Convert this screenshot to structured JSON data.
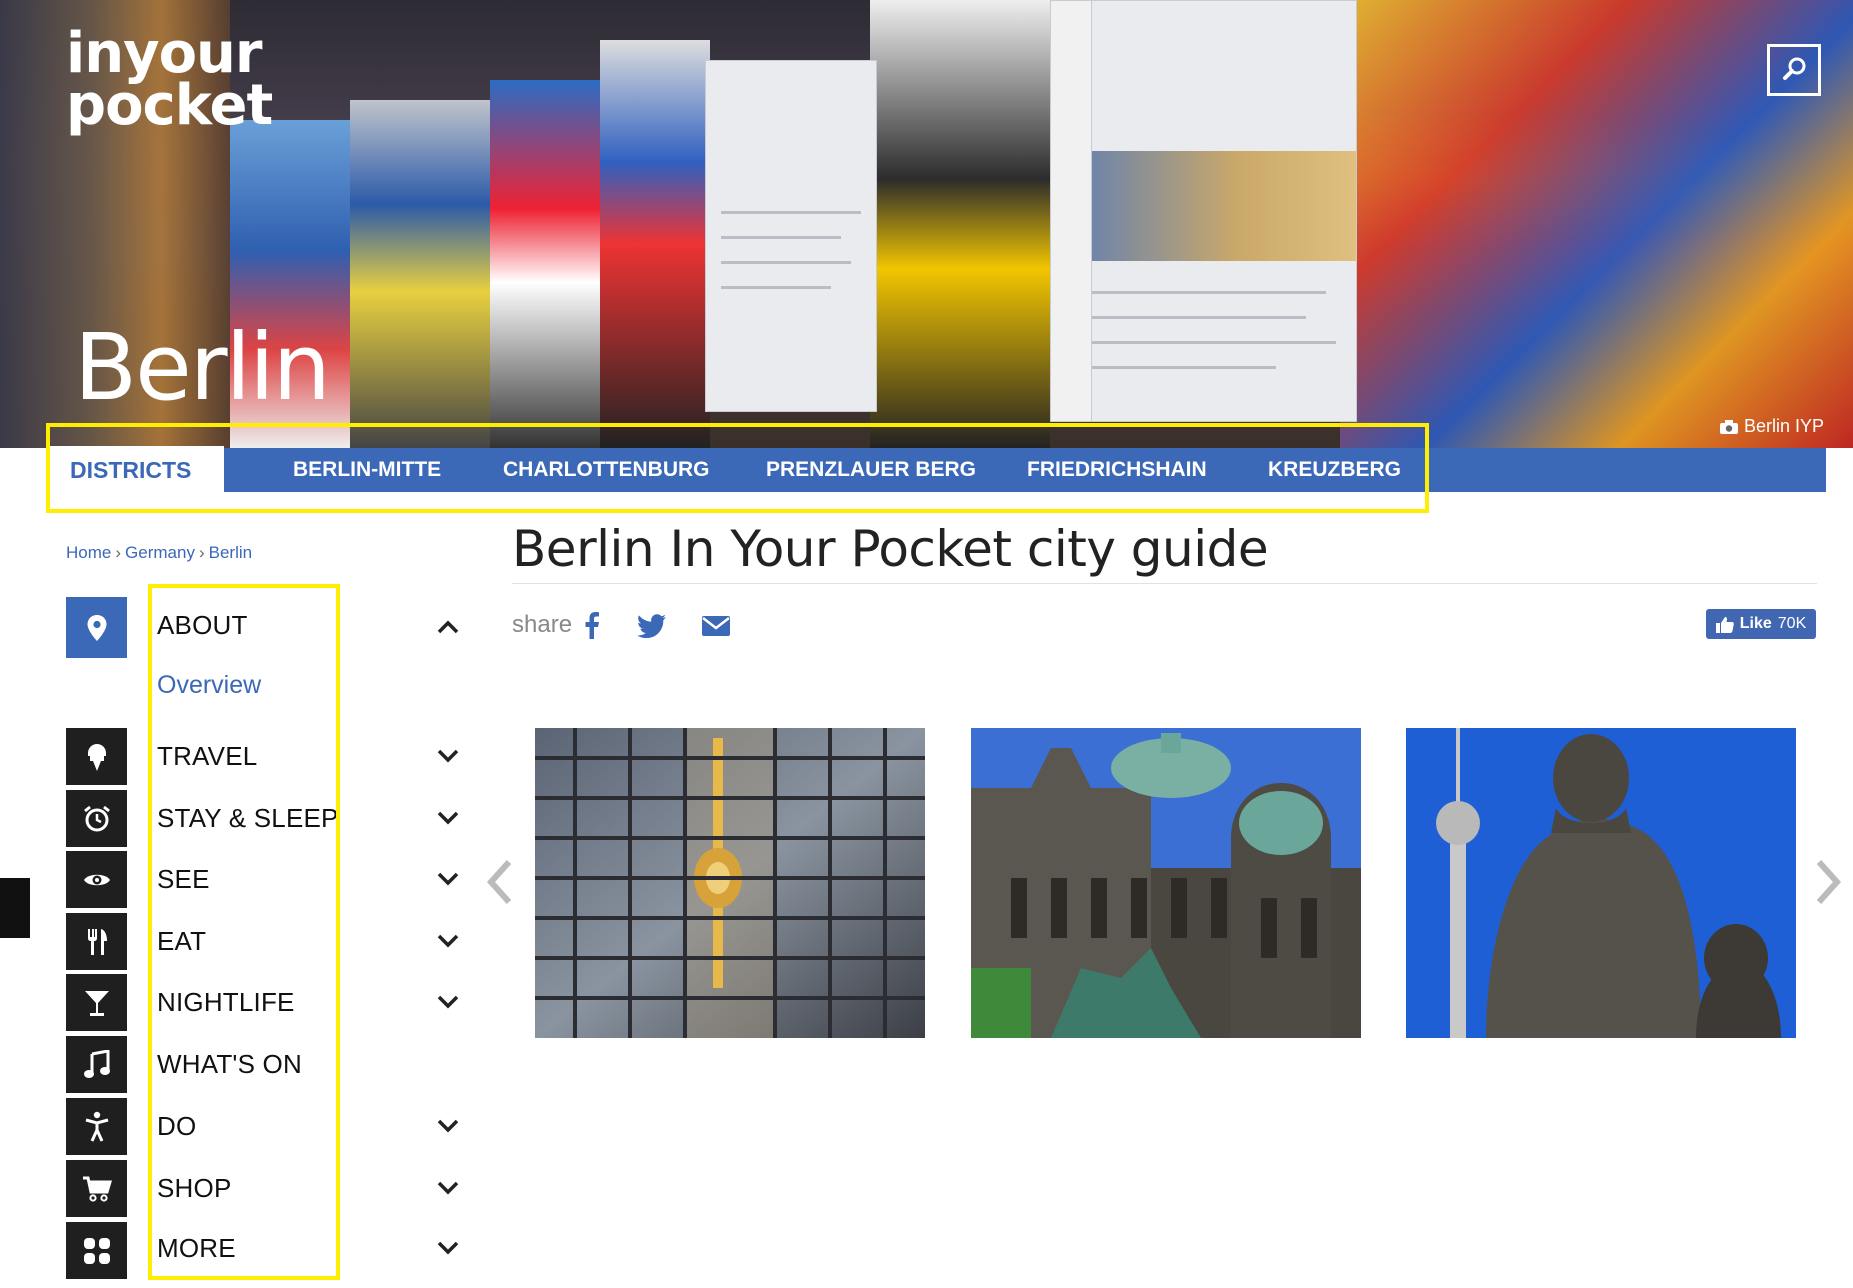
{
  "header": {
    "logo_line1": "inyour",
    "logo_line2": "pocket",
    "city": "Berlin",
    "photo_credit": "Berlin IYP",
    "search_icon": "search-icon",
    "camera_icon": "camera-icon"
  },
  "districts": {
    "label": "DISTRICTS",
    "items": [
      "BERLIN-MITTE",
      "CHARLOTTENBURG",
      "PRENZLAUER BERG",
      "FRIEDRICHSHAIN",
      "KREUZBERG"
    ]
  },
  "breadcrumb": [
    "Home",
    "Germany",
    "Berlin"
  ],
  "sidebar": {
    "items": [
      {
        "label": "ABOUT",
        "icon": "map-pin-icon",
        "state": "expanded",
        "sub": [
          "Overview"
        ]
      },
      {
        "label": "TRAVEL",
        "icon": "ice-cream-icon",
        "state": "collapsed"
      },
      {
        "label": "STAY & SLEEP",
        "icon": "alarm-clock-icon",
        "state": "collapsed"
      },
      {
        "label": "SEE",
        "icon": "eye-icon",
        "state": "collapsed"
      },
      {
        "label": "EAT",
        "icon": "cutlery-icon",
        "state": "collapsed"
      },
      {
        "label": "NIGHTLIFE",
        "icon": "cocktail-icon",
        "state": "collapsed"
      },
      {
        "label": "WHAT'S ON",
        "icon": "music-note-icon",
        "state": "none"
      },
      {
        "label": "DO",
        "icon": "activity-person-icon",
        "state": "collapsed"
      },
      {
        "label": "SHOP",
        "icon": "shopping-cart-icon",
        "state": "collapsed"
      },
      {
        "label": "MORE",
        "icon": "grid-icon",
        "state": "collapsed"
      }
    ]
  },
  "main": {
    "title": "Berlin In Your Pocket city guide",
    "share_label": "share",
    "share_icons": [
      "facebook-icon",
      "twitter-icon",
      "email-icon"
    ],
    "like_label": "Like",
    "like_count": "70K"
  },
  "gallery": {
    "photos": [
      "tv-tower-reflection-photo",
      "berliner-dom-photo",
      "marx-engels-statue-photo"
    ],
    "prev_icon": "chevron-left-icon",
    "next_icon": "chevron-right-icon"
  },
  "colors": {
    "brand_blue": "#3c68b8",
    "highlight": "#ffee00",
    "icon_dark": "#1f1f1f",
    "facebook_blue": "#4267b2"
  }
}
